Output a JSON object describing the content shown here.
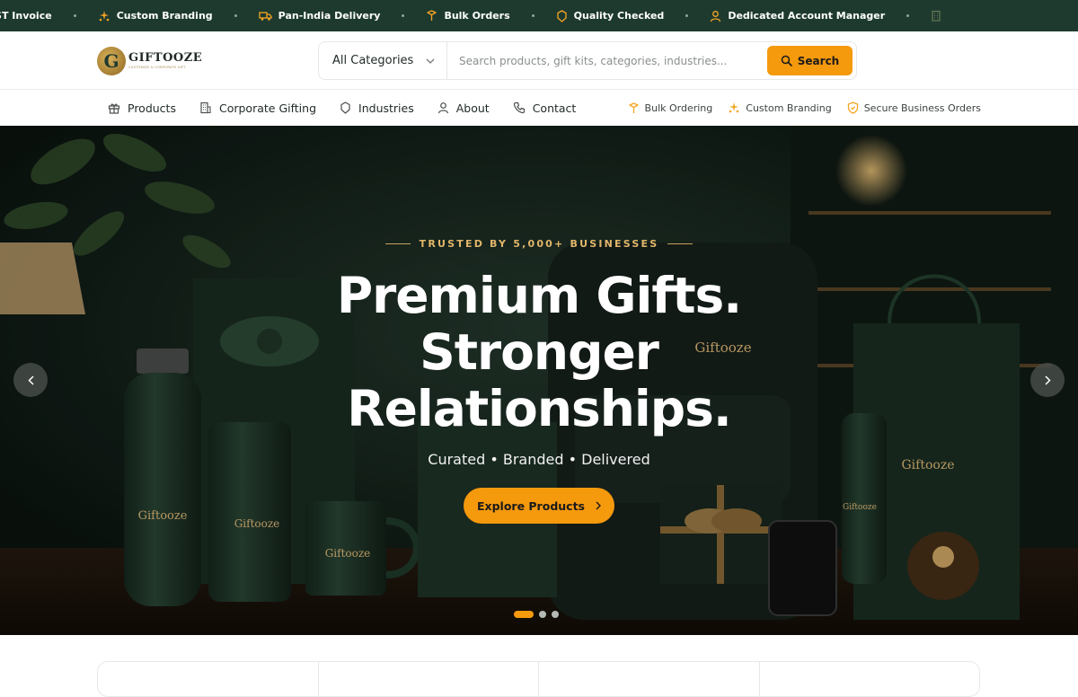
{
  "topbar": {
    "items": [
      {
        "icon": "receipt-icon",
        "label": "GST Invoice"
      },
      {
        "icon": "sparkle-icon",
        "label": "Custom Branding"
      },
      {
        "icon": "truck-icon",
        "label": "Pan-India Delivery"
      },
      {
        "icon": "box-icon",
        "label": "Bulk Orders"
      },
      {
        "icon": "badge-check-icon",
        "label": "Quality Checked"
      },
      {
        "icon": "user-icon",
        "label": "Dedicated Account Manager"
      },
      {
        "icon": "building-icon",
        "label": ""
      }
    ]
  },
  "header": {
    "logo_word": "GIFTOOZE",
    "logo_tagline": "CUSTOMIZE & CORPORATE GIFT",
    "search": {
      "category_label": "All Categories",
      "placeholder": "Search products, gift kits, categories, industries...",
      "button_label": "Search"
    }
  },
  "nav": {
    "items": [
      {
        "icon": "gift-icon",
        "label": "Products"
      },
      {
        "icon": "building-icon",
        "label": "Corporate Gifting"
      },
      {
        "icon": "badge-icon",
        "label": "Industries"
      },
      {
        "icon": "user-icon",
        "label": "About"
      },
      {
        "icon": "phone-icon",
        "label": "Contact"
      }
    ],
    "features": [
      {
        "icon": "box-icon",
        "label": "Bulk Ordering"
      },
      {
        "icon": "sparkle-icon",
        "label": "Custom Branding"
      },
      {
        "icon": "shield-icon",
        "label": "Secure Business Orders"
      }
    ]
  },
  "hero": {
    "eyebrow": "TRUSTED BY 5,000+ BUSINESSES",
    "headline_line1": "Premium Gifts.",
    "headline_line2": "Stronger",
    "headline_line3": "Relationships.",
    "subline": "Curated • Branded • Delivered",
    "cta_label": "Explore Products",
    "product_brand": "Giftooze",
    "slides_total": 3,
    "active_slide": 1
  },
  "colors": {
    "topbar_bg": "#1e3a2f",
    "accent": "#f5990d",
    "gold": "#e2b66a"
  }
}
